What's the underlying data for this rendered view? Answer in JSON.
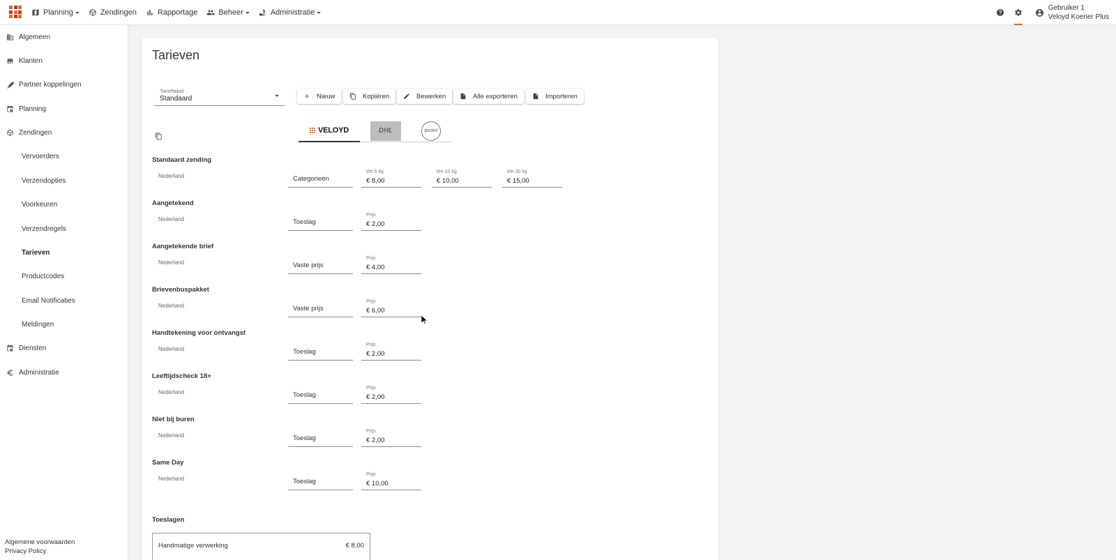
{
  "topnav": {
    "items": [
      {
        "label": "Planning",
        "icon": "map-icon",
        "dropdown": true
      },
      {
        "label": "Zendingen",
        "icon": "package-icon",
        "dropdown": false
      },
      {
        "label": "Rapportage",
        "icon": "bar-chart-icon",
        "dropdown": false
      },
      {
        "label": "Beheer",
        "icon": "people-icon",
        "dropdown": true
      },
      {
        "label": "Administratie",
        "icon": "money-hand-icon",
        "dropdown": true
      }
    ],
    "user": {
      "name": "Gebruiker 1",
      "company": "Veloyd Koerier Plus"
    },
    "accent": "#f26522"
  },
  "sidebar": {
    "items": [
      {
        "label": "Algemeen",
        "icon": "building-icon"
      },
      {
        "label": "Klanten",
        "icon": "store-icon"
      },
      {
        "label": "Partner koppelingen",
        "icon": "plug-icon"
      },
      {
        "label": "Planning",
        "icon": "calendar-clock-icon"
      },
      {
        "label": "Zendingen",
        "icon": "package-icon"
      },
      {
        "label": "Vervoerders",
        "sub": true
      },
      {
        "label": "Verzendopties",
        "sub": true
      },
      {
        "label": "Voorkeuren",
        "sub": true
      },
      {
        "label": "Verzendregels",
        "sub": true
      },
      {
        "label": "Tarieven",
        "sub": true,
        "active": true
      },
      {
        "label": "Productcodes",
        "sub": true
      },
      {
        "label": "Email Notificaties",
        "sub": true
      },
      {
        "label": "Meldingen",
        "sub": true
      },
      {
        "label": "Diensten",
        "icon": "calendar-clock-icon"
      },
      {
        "label": "Administratie",
        "icon": "euro-icon"
      }
    ],
    "footer": [
      "Algemene voorwaarden",
      "Privacy Policy"
    ]
  },
  "main": {
    "title": "Tarieven",
    "tariff_select": {
      "label": "Tarieftabel",
      "value": "Standaard"
    },
    "buttons": {
      "new": "Nieuw",
      "copy": "Kopiëren",
      "edit": "Bewerken",
      "export": "Alle exporteren",
      "import": "Importeren"
    },
    "carriers": {
      "veloyd": "VELOYD",
      "dhl": "DHL",
      "postnl": "postnl",
      "active": "veloyd"
    },
    "sections": [
      {
        "title": "Standaard zending",
        "country": "Nederland",
        "type": "Categorieën",
        "prices": [
          {
            "label": "t/m 5 kg",
            "value": "€ 8,00"
          },
          {
            "label": "t/m 10 kg",
            "value": "€ 10,00"
          },
          {
            "label": "t/m 30 kg",
            "value": "€ 15,00"
          }
        ]
      },
      {
        "title": "Aangetekend",
        "country": "Nederland",
        "type": "Toeslag",
        "prices": [
          {
            "label": "Prijs",
            "value": "€ 2,00"
          }
        ]
      },
      {
        "title": "Aangetekende brief",
        "country": "Nederland",
        "type": "Vaste prijs",
        "prices": [
          {
            "label": "Prijs",
            "value": "€ 4,00"
          }
        ]
      },
      {
        "title": "Brievenbuspakket",
        "country": "Nederland",
        "type": "Vaste prijs",
        "prices": [
          {
            "label": "Prijs",
            "value": "€ 6,00"
          }
        ]
      },
      {
        "title": "Handtekening voor ontvangst",
        "country": "Nederland",
        "type": "Toeslag",
        "prices": [
          {
            "label": "Prijs",
            "value": "€ 2,00"
          }
        ]
      },
      {
        "title": "Leeftijdscheck 18+",
        "country": "Nederland",
        "type": "Toeslag",
        "prices": [
          {
            "label": "Prijs",
            "value": "€ 2,00"
          }
        ]
      },
      {
        "title": "Niet bij buren",
        "country": "Nederland",
        "type": "Toeslag",
        "prices": [
          {
            "label": "Prijs",
            "value": "€ 2,00"
          }
        ]
      },
      {
        "title": "Same Day",
        "country": "Nederland",
        "type": "Toeslag",
        "prices": [
          {
            "label": "Prijs",
            "value": "€ 10,00"
          }
        ]
      }
    ],
    "surcharges": {
      "title": "Toeslagen",
      "items": [
        {
          "name": "Handmatige verwerking",
          "price": "€ 8,00"
        }
      ]
    }
  }
}
